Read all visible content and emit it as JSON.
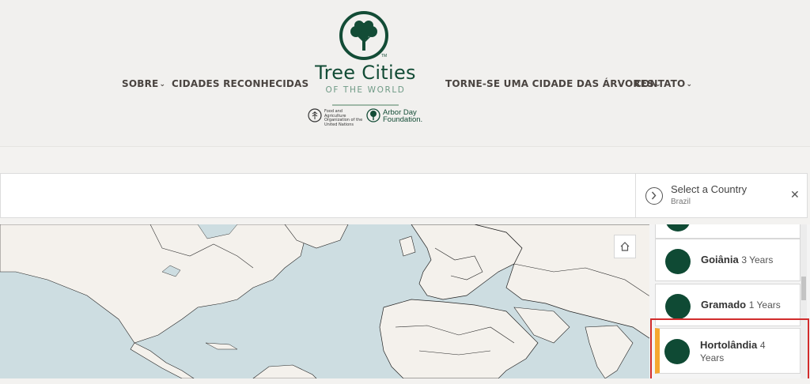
{
  "nav": {
    "about": "SOBRE",
    "recognized": "CIDADES RECONHECIDAS",
    "become": "TORNE-SE UMA CIDADE DAS ÁRVORES",
    "contact": "CONTATO"
  },
  "logo": {
    "title": "Tree Cities",
    "subtitle": "OF THE WORLD",
    "tm": "TM",
    "fao_text": "Food and Agriculture Organization of the United Nations",
    "arbor_text": "Arbor Day Foundation."
  },
  "country_selector": {
    "label": "Select a Country",
    "value": "Brazil"
  },
  "cities": [
    {
      "name": "Goiânia",
      "years": "3 Years"
    },
    {
      "name": "Gramado",
      "years": "1 Years"
    },
    {
      "name": "Hortolândia",
      "years": "4 Years"
    }
  ],
  "icons": {
    "chevron": "chevron-down-icon",
    "arrow": "circle-arrow-right-icon",
    "close": "close-icon",
    "home": "home-icon"
  },
  "colors": {
    "brand_green": "#134c36",
    "selected_accent": "#f5a730",
    "highlight": "#d12c2c"
  }
}
